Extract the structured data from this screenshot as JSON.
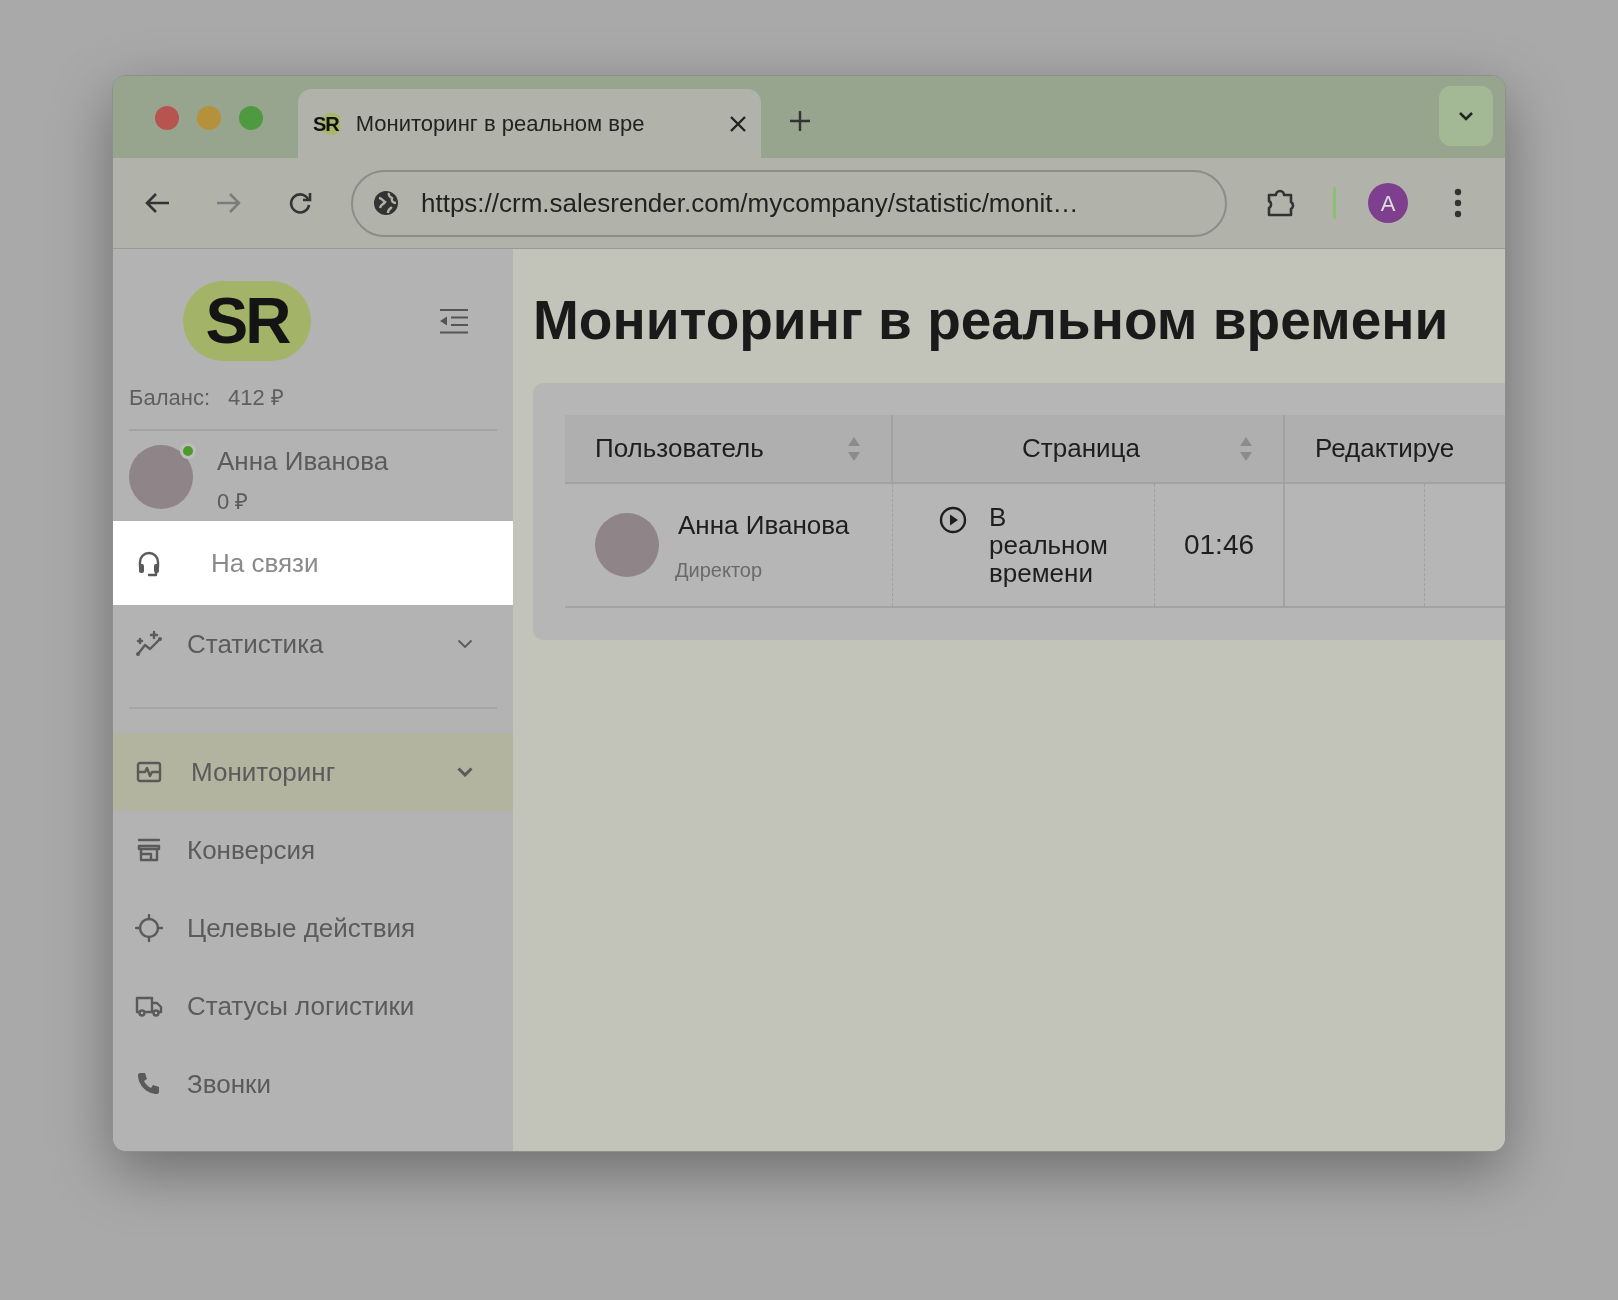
{
  "browser": {
    "tab": {
      "favicon_text": "SR",
      "title": "Мониторинг в реальном вре"
    },
    "url": "https://crm.salesrender.com/mycompany/statistic/monit…",
    "profile_initial": "A"
  },
  "sidebar": {
    "logo_text": "SR",
    "balance_label": "Баланс:",
    "balance": "412 ₽",
    "user": {
      "name": "Анна Иванова",
      "amount": "0 ₽",
      "online": true
    },
    "nav_groups": [
      {
        "items": [
          {
            "label": "На связи",
            "kind": "headset",
            "selected": false,
            "spotlit": true,
            "chevron": false
          },
          {
            "label": "Статистика",
            "kind": "chart",
            "selected": false,
            "spotlit": false,
            "chevron": true
          }
        ]
      },
      {
        "items": [
          {
            "label": "Мониторинг",
            "kind": "monitor",
            "selected": true,
            "spotlit": false,
            "chevron": true
          },
          {
            "label": "Конверсия",
            "kind": "store",
            "selected": false,
            "spotlit": false,
            "chevron": false
          },
          {
            "label": "Целевые действия",
            "kind": "target",
            "selected": false,
            "spotlit": false,
            "chevron": false
          },
          {
            "label": "Статусы логистики",
            "kind": "truck",
            "selected": false,
            "spotlit": false,
            "chevron": false
          },
          {
            "label": "Звонки",
            "kind": "phone",
            "selected": false,
            "spotlit": false,
            "chevron": false
          }
        ]
      }
    ]
  },
  "page": {
    "title": "Мониторинг в реальном времени",
    "table": {
      "columns": [
        {
          "label": "Пользователь",
          "sortable": true
        },
        {
          "label": "Страница",
          "sortable": true
        },
        {
          "label": "Редактируе",
          "sortable": false
        }
      ],
      "rows": [
        {
          "user_name": "Анна Иванова",
          "user_role": "Директор",
          "page": "В реальном времени",
          "duration": "01:46"
        }
      ]
    }
  }
}
